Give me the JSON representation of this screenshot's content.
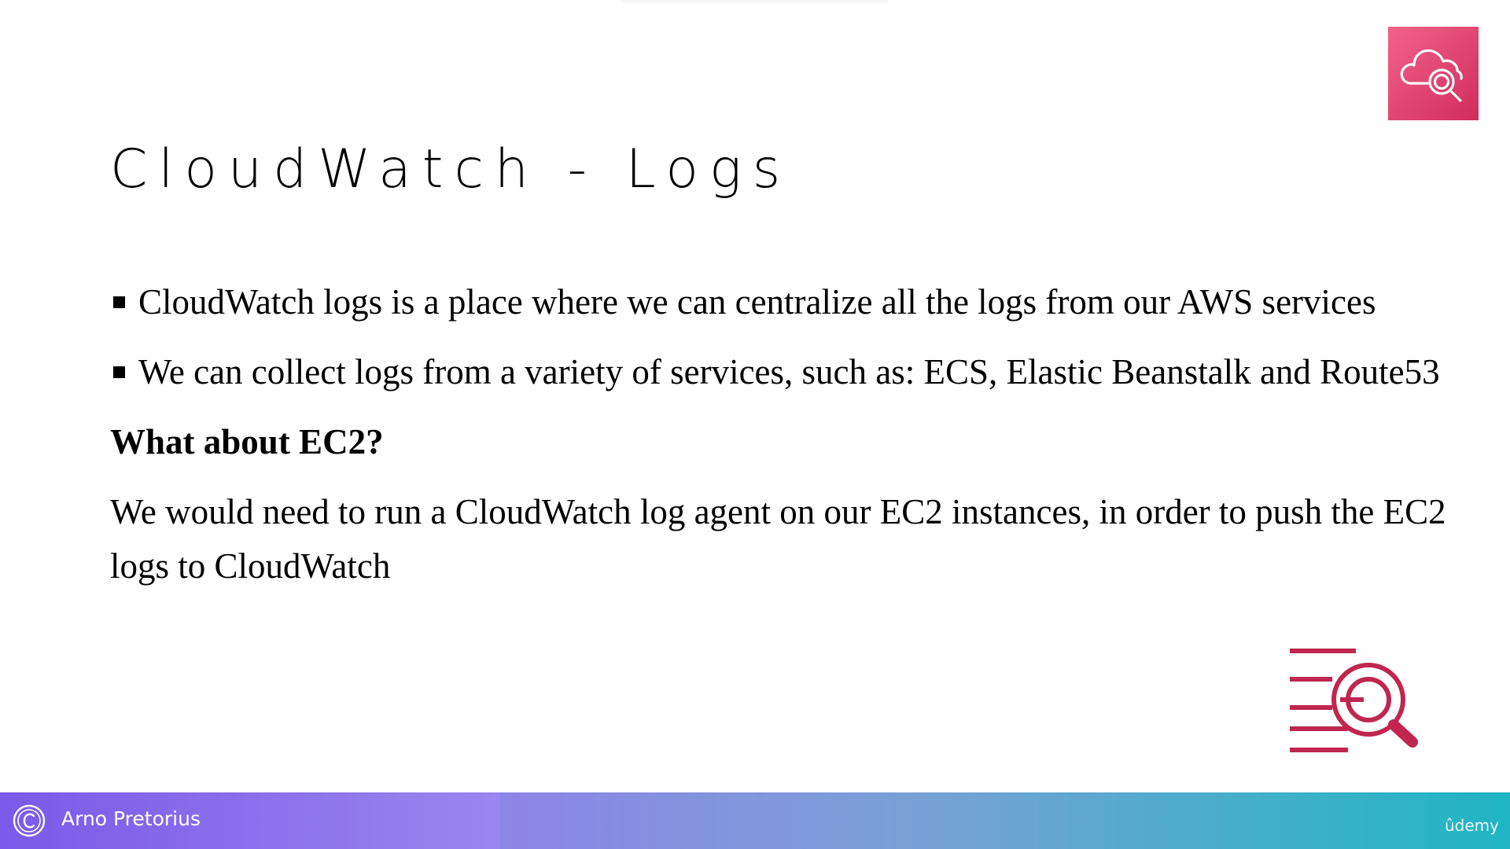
{
  "slide": {
    "title": "CloudWatch - Logs",
    "bullets": [
      {
        "text": "CloudWatch logs is a place where we can centralize all the logs from our AWS services"
      },
      {
        "text": "We can collect logs from a variety of services, such as: ECS, Elastic Beanstalk and Route53"
      }
    ],
    "subheading": "What about EC2?",
    "paragraph": "We would need to run a CloudWatch log agent on our EC2 instances, in order to push the EC2 logs to CloudWatch"
  },
  "icons": {
    "top_right": "cloudwatch-search-icon",
    "bottom_right": "logs-search-icon",
    "footer": "copyright-icon"
  },
  "footer": {
    "author": "Arno Pretorius",
    "brand": "ûdemy"
  },
  "colors": {
    "badge": "#e0356a",
    "logs_icon": "#c0264f",
    "footer_start": "#7b5ce8",
    "footer_end": "#1fb5c4"
  }
}
